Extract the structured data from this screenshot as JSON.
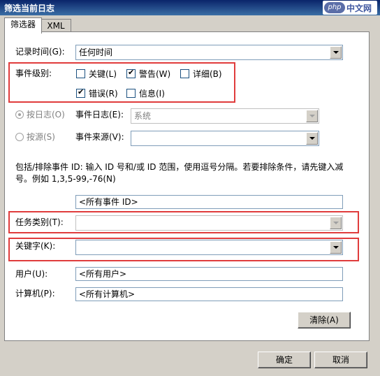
{
  "window": {
    "title": "筛选当前日志",
    "logo_mark": "php",
    "logo_text": "中文网"
  },
  "tabs": [
    {
      "label": "筛选器",
      "active": true
    },
    {
      "label": "XML",
      "active": false
    }
  ],
  "filter": {
    "logged_label": "记录时间(G):",
    "logged_value": "任何时间",
    "event_level_label": "事件级别:",
    "levels": [
      {
        "label": "关键(L)",
        "checked": false
      },
      {
        "label": "警告(W)",
        "checked": true
      },
      {
        "label": "详细(B)",
        "checked": false
      },
      {
        "label": "错误(R)",
        "checked": true
      },
      {
        "label": "信息(I)",
        "checked": false
      }
    ],
    "by_log_label": "按日志(O)",
    "event_logs_label": "事件日志(E):",
    "event_logs_value": "系统",
    "by_source_label": "按源(S)",
    "event_sources_label": "事件来源(V):",
    "event_sources_value": "",
    "event_id_help": "包括/排除事件 ID: 输入 ID 号和/或 ID 范围，使用逗号分隔。若要排除条件，请先键入减号。例如 1,3,5-99,-76(N)",
    "event_id_value": "<所有事件 ID>",
    "task_category_label": "任务类别(T):",
    "task_category_value": "",
    "keywords_label": "关键字(K):",
    "keywords_value": "",
    "user_label": "用户(U):",
    "user_value": "<所有用户>",
    "computer_label": "计算机(P):",
    "computer_value": "<所有计算机>",
    "clear_label": "清除(A)"
  },
  "buttons": {
    "ok": "确定",
    "cancel": "取消"
  },
  "colors": {
    "highlight": "#e03c3c",
    "titlebar": "#0a246a"
  }
}
